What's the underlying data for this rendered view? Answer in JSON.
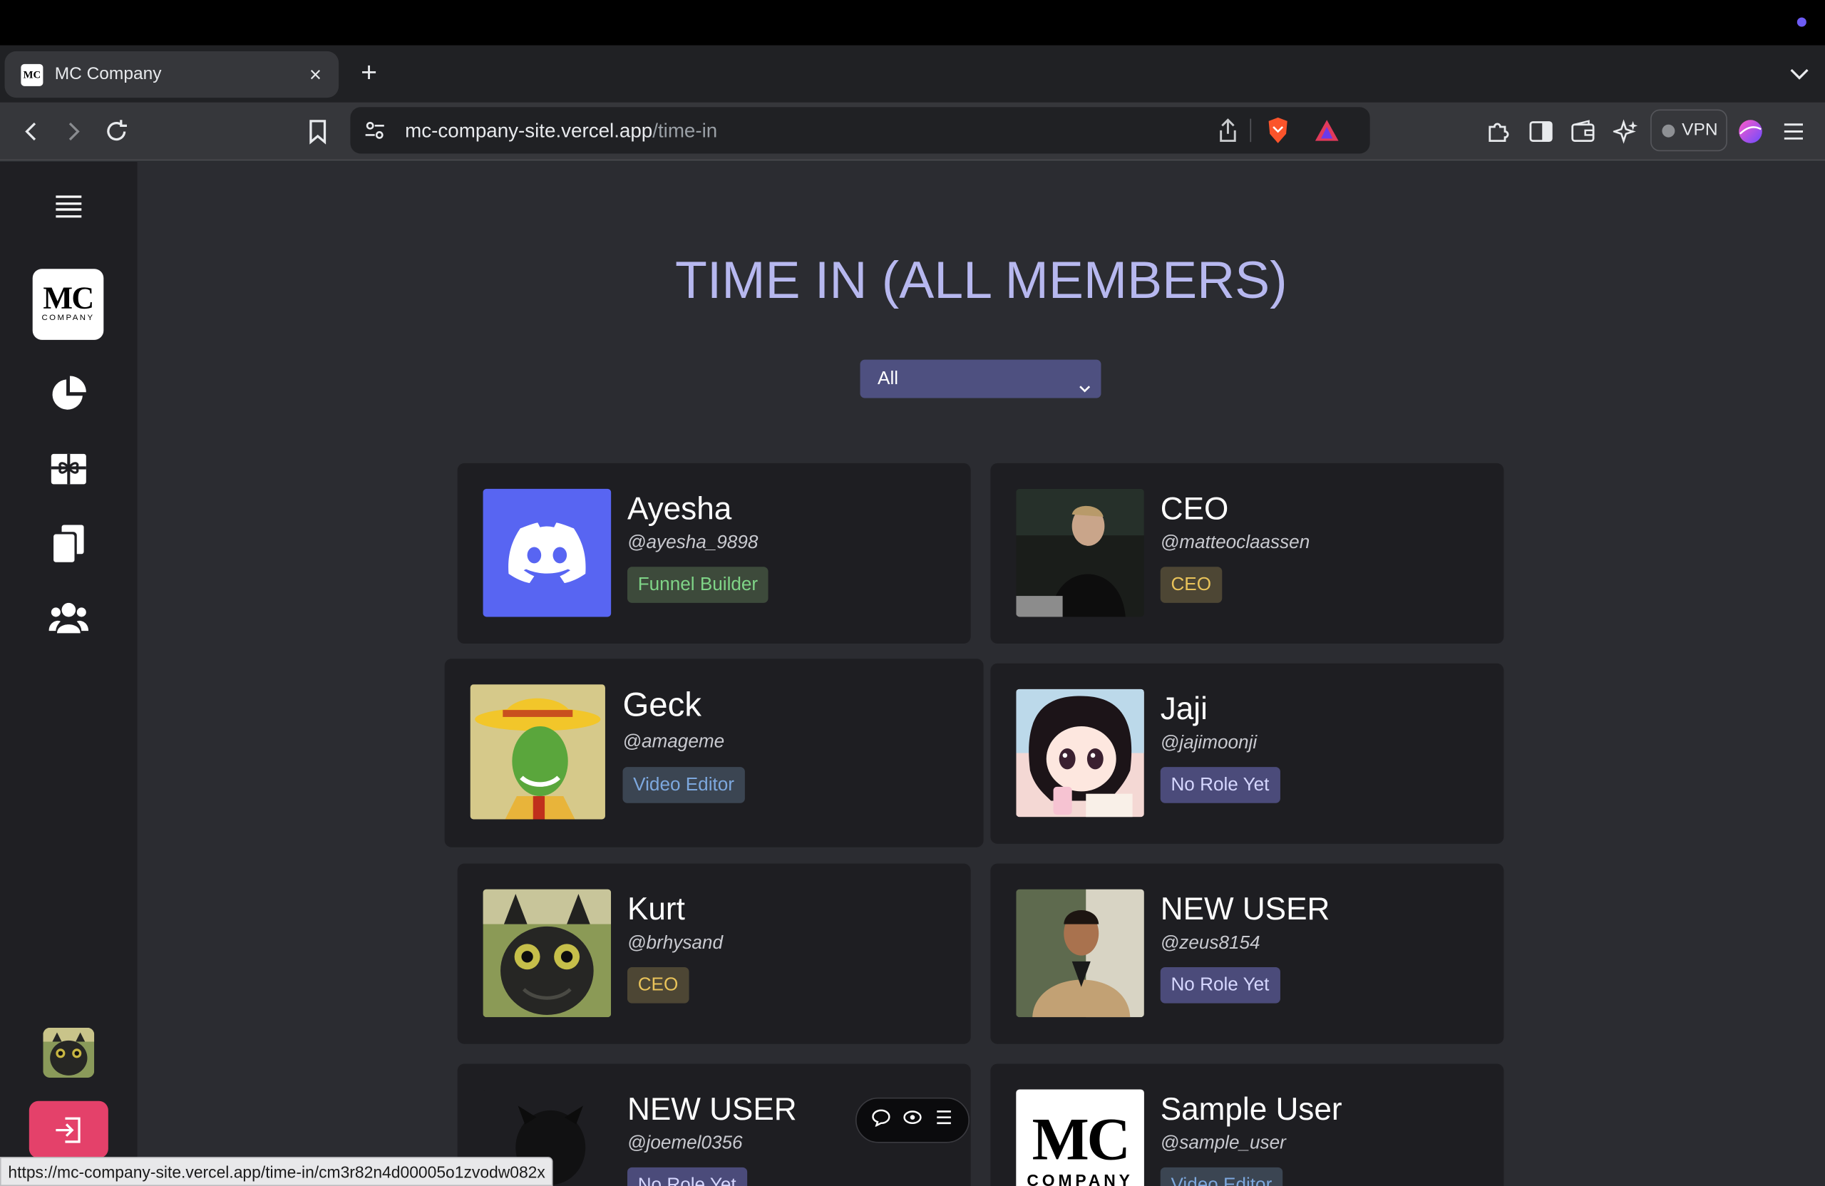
{
  "browser": {
    "tab_title": "MC Company",
    "favicon_text": "MC",
    "tab_close": "×",
    "new_tab": "+",
    "url_host": "mc-company-site.vercel.app",
    "url_path": "/time-in",
    "vpn_label": "VPN",
    "status_url": "https://mc-company-site.vercel.app/time-in/cm3r82n4d00005o1zvodw082x"
  },
  "sidebar": {
    "logo_mc": "MC",
    "logo_company": "COMPANY",
    "items": [
      "menu-icon",
      "pie-chart-icon",
      "gift-icon",
      "copy-icon",
      "users-icon"
    ]
  },
  "page": {
    "title": "TIME IN (ALL MEMBERS)",
    "filter": {
      "selected": "All"
    }
  },
  "members": [
    {
      "name": "Ayesha",
      "handle": "@ayesha_9898",
      "role": "Funnel Builder",
      "avatar": "discord-logo"
    },
    {
      "name": "CEO",
      "handle": "@matteoclaassen",
      "role": "CEO",
      "avatar": "photo-man-black-shirt"
    },
    {
      "name": "Geck",
      "handle": "@amageme",
      "role": "Video Editor",
      "avatar": "photo-green-mask-yellow-hat"
    },
    {
      "name": "Jaji",
      "handle": "@jajimoonji",
      "role": "No Role Yet",
      "avatar": "anime-girl-drawing"
    },
    {
      "name": "Kurt",
      "handle": "@brhysand",
      "role": "CEO",
      "avatar": "toothless-dragon"
    },
    {
      "name": "NEW USER",
      "handle": "@zeus8154",
      "role": "No Role Yet",
      "avatar": "photo-man-tan-suit"
    },
    {
      "name": "NEW USER",
      "handle": "@joemel0356",
      "role": "No Role Yet",
      "avatar": "photo-dark-dog"
    },
    {
      "name": "Sample User",
      "handle": "@sample_user",
      "role": "Video Editor",
      "avatar": "mc-company-logo"
    }
  ],
  "logo_text": {
    "mc": "MC",
    "company": "COMPANY"
  },
  "colors": {
    "title": "#b7b8ef",
    "filter_bg": "#4e5080",
    "logout": "#e4416a",
    "discord": "#5865f2"
  }
}
